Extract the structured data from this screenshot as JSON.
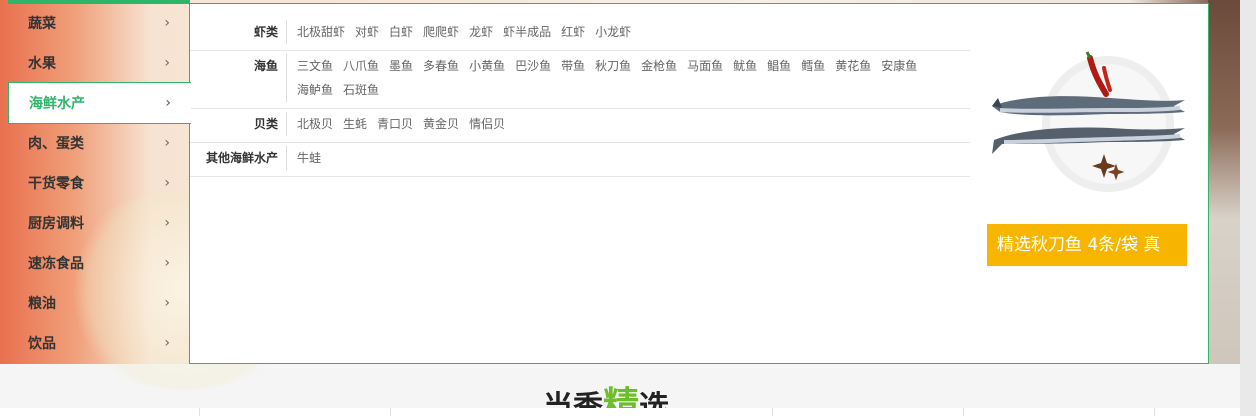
{
  "menu": {
    "items": [
      {
        "label": "蔬菜",
        "active": false
      },
      {
        "label": "水果",
        "active": false
      },
      {
        "label": "海鲜水产",
        "active": true
      },
      {
        "label": "肉、蛋类",
        "active": false
      },
      {
        "label": "干货零食",
        "active": false
      },
      {
        "label": "厨房调料",
        "active": false
      },
      {
        "label": "速冻食品",
        "active": false
      },
      {
        "label": "粮油",
        "active": false
      },
      {
        "label": "饮品",
        "active": false
      }
    ],
    "chevron": "›"
  },
  "submenu": {
    "rows": [
      {
        "title": "虾类",
        "items": [
          "北极甜虾",
          "对虾",
          "白虾",
          "爬爬虾",
          "龙虾",
          "虾半成品",
          "红虾",
          "小龙虾"
        ]
      },
      {
        "title": "海鱼",
        "items": [
          "三文鱼",
          "八爪鱼",
          "墨鱼",
          "多春鱼",
          "小黄鱼",
          "巴沙鱼",
          "带鱼",
          "秋刀鱼",
          "金枪鱼",
          "马面鱼",
          "鱿鱼",
          "鲳鱼",
          "鳕鱼",
          "黄花鱼",
          "安康鱼",
          "海鲈鱼",
          "石斑鱼"
        ]
      },
      {
        "title": "贝类",
        "items": [
          "北极贝",
          "生蚝",
          "青口贝",
          "黄金贝",
          "情侣贝"
        ]
      },
      {
        "title": "其他海鲜水产",
        "items": [
          "牛蛙"
        ]
      }
    ]
  },
  "promo": {
    "label": "精选秋刀鱼 4条/袋 真",
    "image_icon": "saury-fish-plate-icon",
    "label_bg": "#f7b500"
  },
  "section": {
    "title_pre": "当季",
    "title_accent": "精",
    "title_post": "选"
  },
  "colors": {
    "accent": "#2db56a"
  }
}
